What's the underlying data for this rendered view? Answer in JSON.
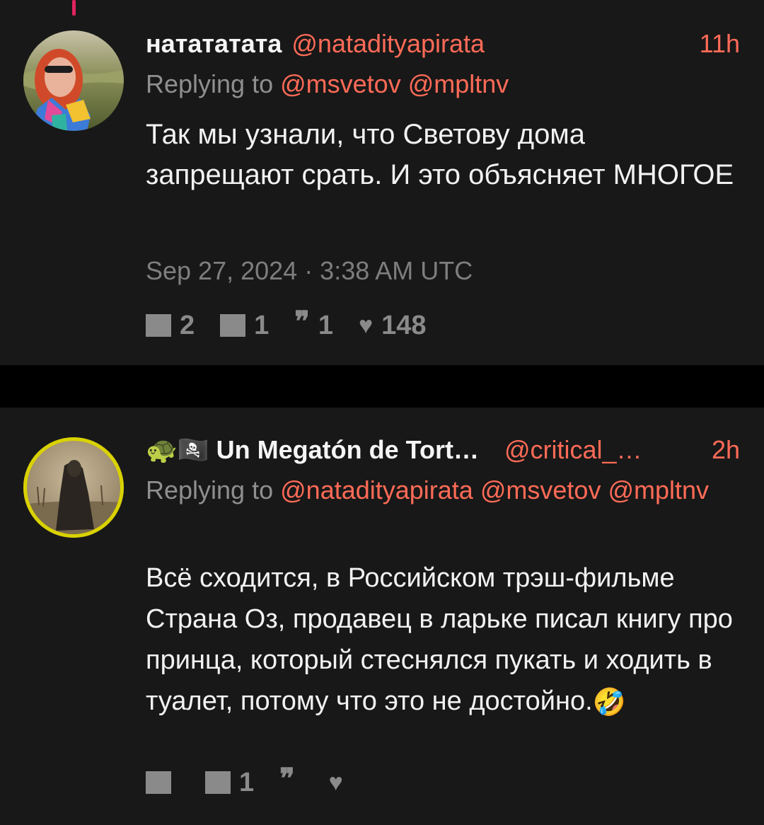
{
  "tweets": [
    {
      "name": "нататататa",
      "handle": "@natadityapirata",
      "time": "11h",
      "replying_prefix": "Replying to",
      "mentions": [
        "@msvetov",
        "@mpltnv"
      ],
      "body": "Так мы узнали, что Светову дома запрещают срать. И это объясняет МНОГОЕ",
      "timestamp": "Sep 27, 2024 · 3:38 AM UTC",
      "stats": {
        "replies": "2",
        "retweets": "1",
        "quotes": "1",
        "likes": "148"
      },
      "avatar_icon": "user-avatar-photo"
    },
    {
      "name_emoji": "🐢🏴‍☠️",
      "name": "Un Megatón de Tort…",
      "handle": "@critical_…",
      "time": "2h",
      "replying_prefix": "Replying to",
      "mentions": [
        "@natadityapirata",
        "@msvetov",
        "@mpltnv"
      ],
      "body": "Всё сходится, в Российском трэш-фильме Страна Оз, продавец в ларьке писал книгу про принца, который стеснялся пукать и ходить в туалет, потому что это не достойно.",
      "body_emoji": "🤣",
      "stats": {
        "replies": "",
        "retweets": "1",
        "quotes": "",
        "likes": ""
      },
      "avatar_icon": "painting-avatar"
    }
  ],
  "colors": {
    "background": "#000000",
    "card": "#181818",
    "accent": "#ff6b57",
    "muted": "#8f8f8f",
    "thread_line": "#e0245e",
    "avatar_ring": "#d9d200"
  }
}
